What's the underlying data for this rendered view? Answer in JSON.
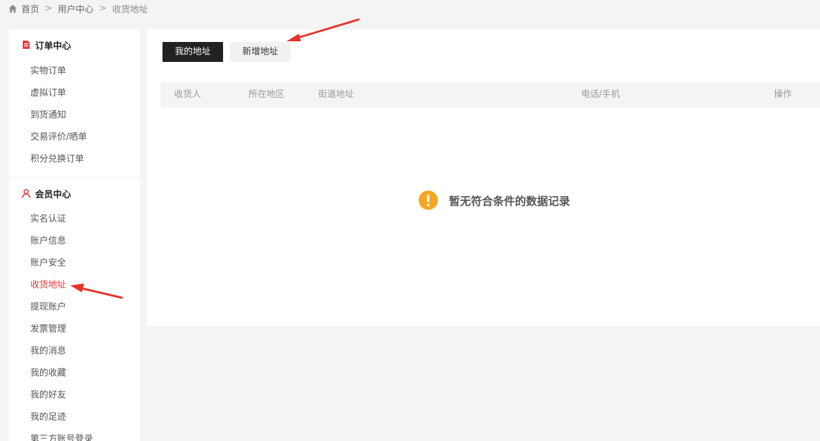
{
  "breadcrumb": {
    "home": "首页",
    "separator": ">",
    "user_center": "用户中心",
    "current": "收货地址"
  },
  "sidebar": {
    "orders": {
      "title": "订单中心",
      "icon": "order-doc-icon",
      "items": [
        {
          "label": "实物订单"
        },
        {
          "label": "虚拟订单"
        },
        {
          "label": "到货通知"
        },
        {
          "label": "交易评价/晒单"
        },
        {
          "label": "积分兑换订单"
        }
      ]
    },
    "member": {
      "title": "会员中心",
      "icon": "user-icon",
      "items": [
        {
          "label": "实名认证"
        },
        {
          "label": "账户信息"
        },
        {
          "label": "账户安全"
        },
        {
          "label": "收货地址",
          "active": true
        },
        {
          "label": "提现账户"
        },
        {
          "label": "发票管理"
        },
        {
          "label": "我的消息"
        },
        {
          "label": "我的收藏"
        },
        {
          "label": "我的好友"
        },
        {
          "label": "我的足迹"
        },
        {
          "label": "第三方账号登录"
        }
      ]
    }
  },
  "tabs": {
    "my_address": "我的地址",
    "add_address": "新增地址"
  },
  "table": {
    "columns": {
      "receiver": "收货人",
      "region": "所在地区",
      "street": "街道地址",
      "phone": "电话/手机",
      "action": "操作"
    }
  },
  "empty": {
    "message": "暂无符合条件的数据记录",
    "icon": "warning-icon"
  },
  "colors": {
    "accent_red": "#e4393c",
    "warning_orange": "#f5a623",
    "tab_dark": "#222222"
  }
}
